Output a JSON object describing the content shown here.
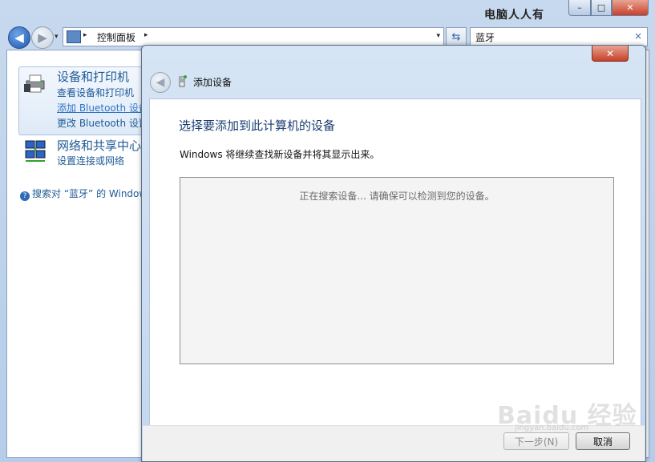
{
  "watermark_top": "电脑人人有",
  "window_controls": {
    "minimize": "–",
    "maximize": "□",
    "close": "✕"
  },
  "address_bar": {
    "path": "控制面板",
    "arrow": "▸",
    "dropdown": "▾"
  },
  "search": {
    "value": "蓝牙",
    "clear": "×"
  },
  "sidebar": {
    "category1": {
      "title": "设备和打印机",
      "links": [
        "查看设备和打印机",
        "添加 Bluetooth 设备",
        "更改 Bluetooth 设置"
      ]
    },
    "category2": {
      "title": "网络和共享中心",
      "links": [
        "设置连接或网络"
      ]
    },
    "search_windows": "搜索对 “蓝牙” 的 Windows 帮助"
  },
  "dialog": {
    "close": "✕",
    "title": "添加设备",
    "heading": "选择要添加到此计算机的设备",
    "subtext": "Windows 将继续查找新设备并将其显示出来。",
    "status": "正在搜索设备... 请确保可以检测到您的设备。",
    "buttons": {
      "next": "下一步(N)",
      "cancel": "取消"
    }
  },
  "watermark": {
    "logo": "Baidu 经验",
    "url": "jingyan.baidu.com"
  },
  "icons": {
    "back": "back-arrow-icon",
    "forward": "forward-arrow-icon",
    "refresh": "refresh-icon",
    "printer": "printer-icon",
    "network": "network-icon",
    "help": "help-icon"
  }
}
